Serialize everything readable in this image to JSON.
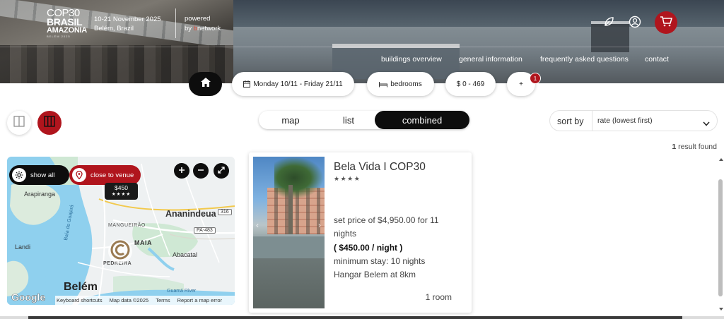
{
  "header": {
    "logo": {
      "line1": "COP30",
      "line2": "BRASIL",
      "line3": "AMAZONIA",
      "line4": "BELÉM 2025"
    },
    "event_dates": "10-21 November 2025",
    "event_city": "Belém, Brazil",
    "powered_line1": "powered",
    "powered_by": "by ",
    "powered_brand_initial": "b",
    "powered_brand_rest": "network",
    "icons": {
      "eco": "leaf-icon",
      "account": "user-circle-icon",
      "cart": "cart-icon"
    },
    "nav": [
      {
        "label": "buildings overview"
      },
      {
        "label": "general information"
      },
      {
        "label": "frequently asked questions"
      },
      {
        "label": "contact"
      }
    ]
  },
  "filters": {
    "dates": "Monday 10/11 - Friday 21/11",
    "bedrooms": "bedrooms",
    "price": "$ 0 - 469",
    "more": "+",
    "more_badge": "1"
  },
  "view": {
    "options": [
      "map",
      "list",
      "combined"
    ],
    "selected": "combined"
  },
  "sort": {
    "label": "sort by",
    "value": "rate (lowest first)"
  },
  "results": {
    "count": "1",
    "suffix": " result found"
  },
  "map": {
    "show_all": "show all",
    "close_to_venue": "close to venue",
    "marker_price": "$450",
    "marker_stars": "★★★★",
    "labels": {
      "arapiranga": "Arapiranga",
      "ananindeua": "Ananindeua",
      "mangueirao": "MANGUEIRÃO",
      "maia": "MAIA",
      "landi": "Landi",
      "pedreira": "PEDREIRA",
      "abacatal": "Abacatal",
      "belem": "Belém",
      "bay": "Baía do Guajará",
      "river": "Guamá River",
      "road1": "316",
      "road2": "PA-483"
    },
    "google": "Google",
    "attribution": [
      "Keyboard shortcuts",
      "Map data ©2025",
      "Terms",
      "Report a map error"
    ],
    "colors": {
      "water": "#8fd0ee",
      "land": "#eef1f2",
      "green": "#cfe8d4",
      "accent": "#b0151d"
    }
  },
  "listing": {
    "title": "Bela Vida I COP30",
    "stars": "★★★★",
    "price_line1": "set price of  $4,950.00 for 11",
    "price_line2": "nights",
    "per_night": "( $450.00 / night )",
    "min_stay": "minimum stay: 10 nights",
    "distance": "Hangar Belem at 8km",
    "rooms": "1 room"
  },
  "theme": {
    "accent": "#b0151d",
    "dark": "#0d0d0d"
  }
}
